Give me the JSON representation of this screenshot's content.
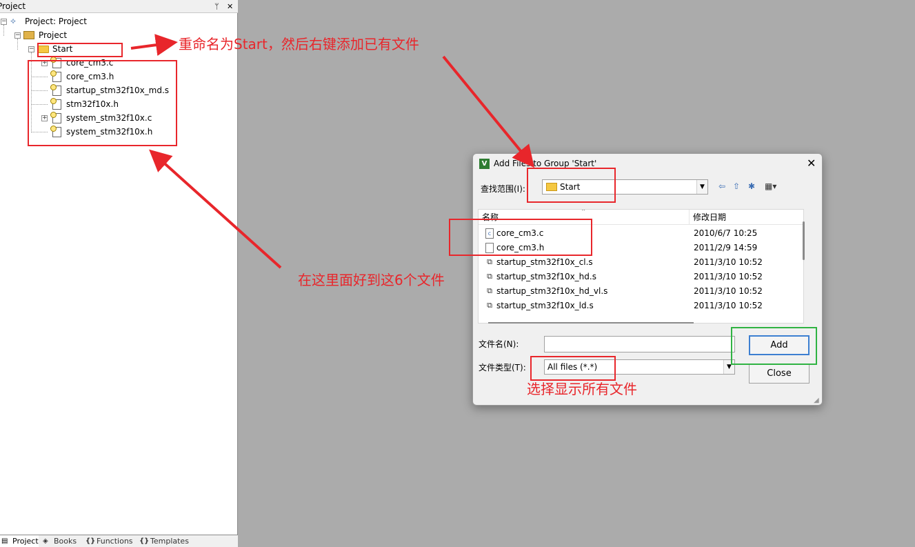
{
  "left_pane": {
    "title": "Project",
    "pin_glyph": "ᛘ",
    "close_glyph": "✕",
    "tree": {
      "root_label": "Project: Project",
      "project_label": "Project",
      "group_label": "Start",
      "files": [
        {
          "name": "core_cm3.c",
          "expandable": true
        },
        {
          "name": "core_cm3.h",
          "expandable": false
        },
        {
          "name": "startup_stm32f10x_md.s",
          "expandable": false
        },
        {
          "name": "stm32f10x.h",
          "expandable": false
        },
        {
          "name": "system_stm32f10x.c",
          "expandable": true
        },
        {
          "name": "system_stm32f10x.h",
          "expandable": false
        }
      ]
    },
    "bottom_tabs": [
      "Project",
      "Books",
      "Functions",
      "Templates"
    ]
  },
  "annotations": {
    "rename_note": "重命名为Start，然后右键添加已有文件",
    "find_files_note": "在这里面好到这6个文件",
    "file_type_note": "选择显示所有文件"
  },
  "dialog": {
    "title": "Add Files to Group 'Start'",
    "lookin_label": "查找范围(I):",
    "lookin_value": "Start",
    "column_name": "名称",
    "column_date": "修改日期",
    "files": [
      {
        "name": "core_cm3.c",
        "date": "2010/6/7 10:25"
      },
      {
        "name": "core_cm3.h",
        "date": "2011/2/9 14:59"
      },
      {
        "name": "startup_stm32f10x_cl.s",
        "date": "2011/3/10 10:52"
      },
      {
        "name": "startup_stm32f10x_hd.s",
        "date": "2011/3/10 10:52"
      },
      {
        "name": "startup_stm32f10x_hd_vl.s",
        "date": "2011/3/10 10:52"
      },
      {
        "name": "startup_stm32f10x_ld.s",
        "date": "2011/3/10 10:52"
      }
    ],
    "filename_label": "文件名(N):",
    "filename_value": "",
    "filetype_label": "文件类型(T):",
    "filetype_value": "All files (*.*)",
    "add_button": "Add",
    "close_button": "Close"
  },
  "colors": {
    "annotation_red": "#e8262b",
    "annotation_green": "#2fb342",
    "desktop_gray": "#ababab"
  }
}
